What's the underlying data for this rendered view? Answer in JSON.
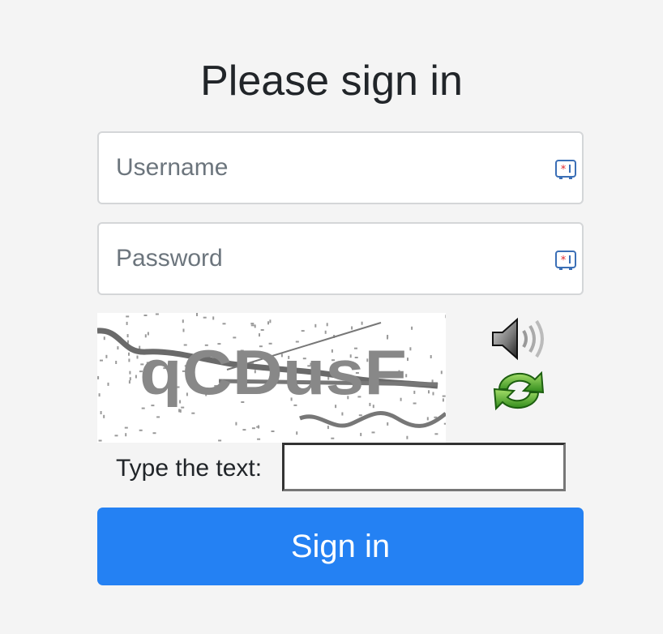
{
  "page": {
    "title": "Please sign in"
  },
  "form": {
    "username": {
      "placeholder": "Username",
      "value": ""
    },
    "password": {
      "placeholder": "Password",
      "value": ""
    },
    "captcha": {
      "image_text": "qCDusF",
      "label": "Type the text:",
      "value": "",
      "audio_icon": "speaker-icon",
      "refresh_icon": "refresh-icon"
    },
    "submit_label": "Sign in"
  },
  "colors": {
    "background": "#f4f4f4",
    "primary": "#2481f3",
    "field_border": "#d4d6d8",
    "keeper_icon": "#3b6fb6",
    "keeper_star": "#e0262b"
  }
}
